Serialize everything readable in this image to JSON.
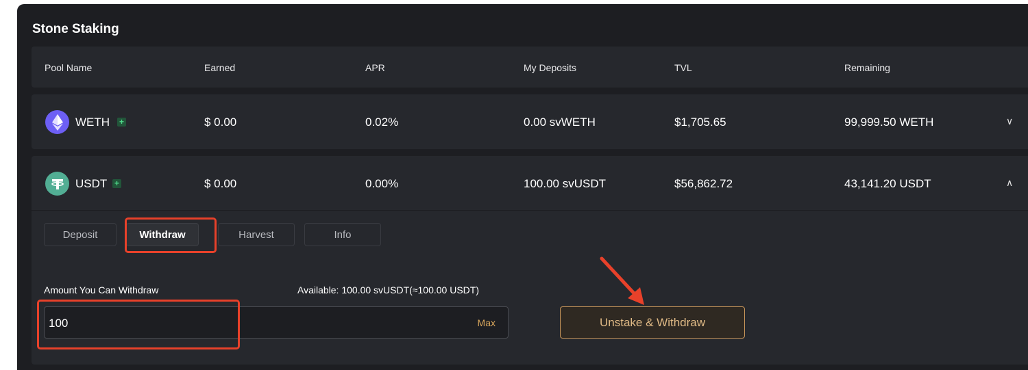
{
  "panel": {
    "title": "Stone Staking"
  },
  "table": {
    "headers": [
      "Pool Name",
      "Earned",
      "APR",
      "My Deposits",
      "TVL",
      "Remaining"
    ],
    "rows": [
      {
        "pool": "WETH",
        "earned": "$ 0.00",
        "apr": "0.02%",
        "deposits": "0.00 svWETH",
        "tvl": "$1,705.65",
        "remaining": "99,999.50 WETH",
        "chevron": "∨"
      },
      {
        "pool": "USDT",
        "earned": "$ 0.00",
        "apr": "0.00%",
        "deposits": "100.00 svUSDT",
        "tvl": "$56,862.72",
        "remaining": "43,141.20 USDT",
        "chevron": "∧"
      }
    ]
  },
  "badge": "+",
  "tabs": {
    "deposit": "Deposit",
    "withdraw": "Withdraw",
    "harvest": "Harvest",
    "info": "Info",
    "active": "Withdraw"
  },
  "withdraw": {
    "amount_label": "Amount You Can Withdraw",
    "available": "Available: 100.00 svUSDT(≈100.00 USDT)",
    "input_value": "100",
    "max_label": "Max",
    "submit_label": "Unstake & Withdraw"
  },
  "icons": {
    "weth": "ethereum-icon",
    "usdt": "tether-icon",
    "chevron_down": "chevron-down-icon",
    "chevron_up": "chevron-up-icon"
  },
  "colors": {
    "accent": "#c8965a",
    "annotation": "#e8412a",
    "panel_bg": "#1d1e22",
    "row_bg": "#26282d"
  }
}
